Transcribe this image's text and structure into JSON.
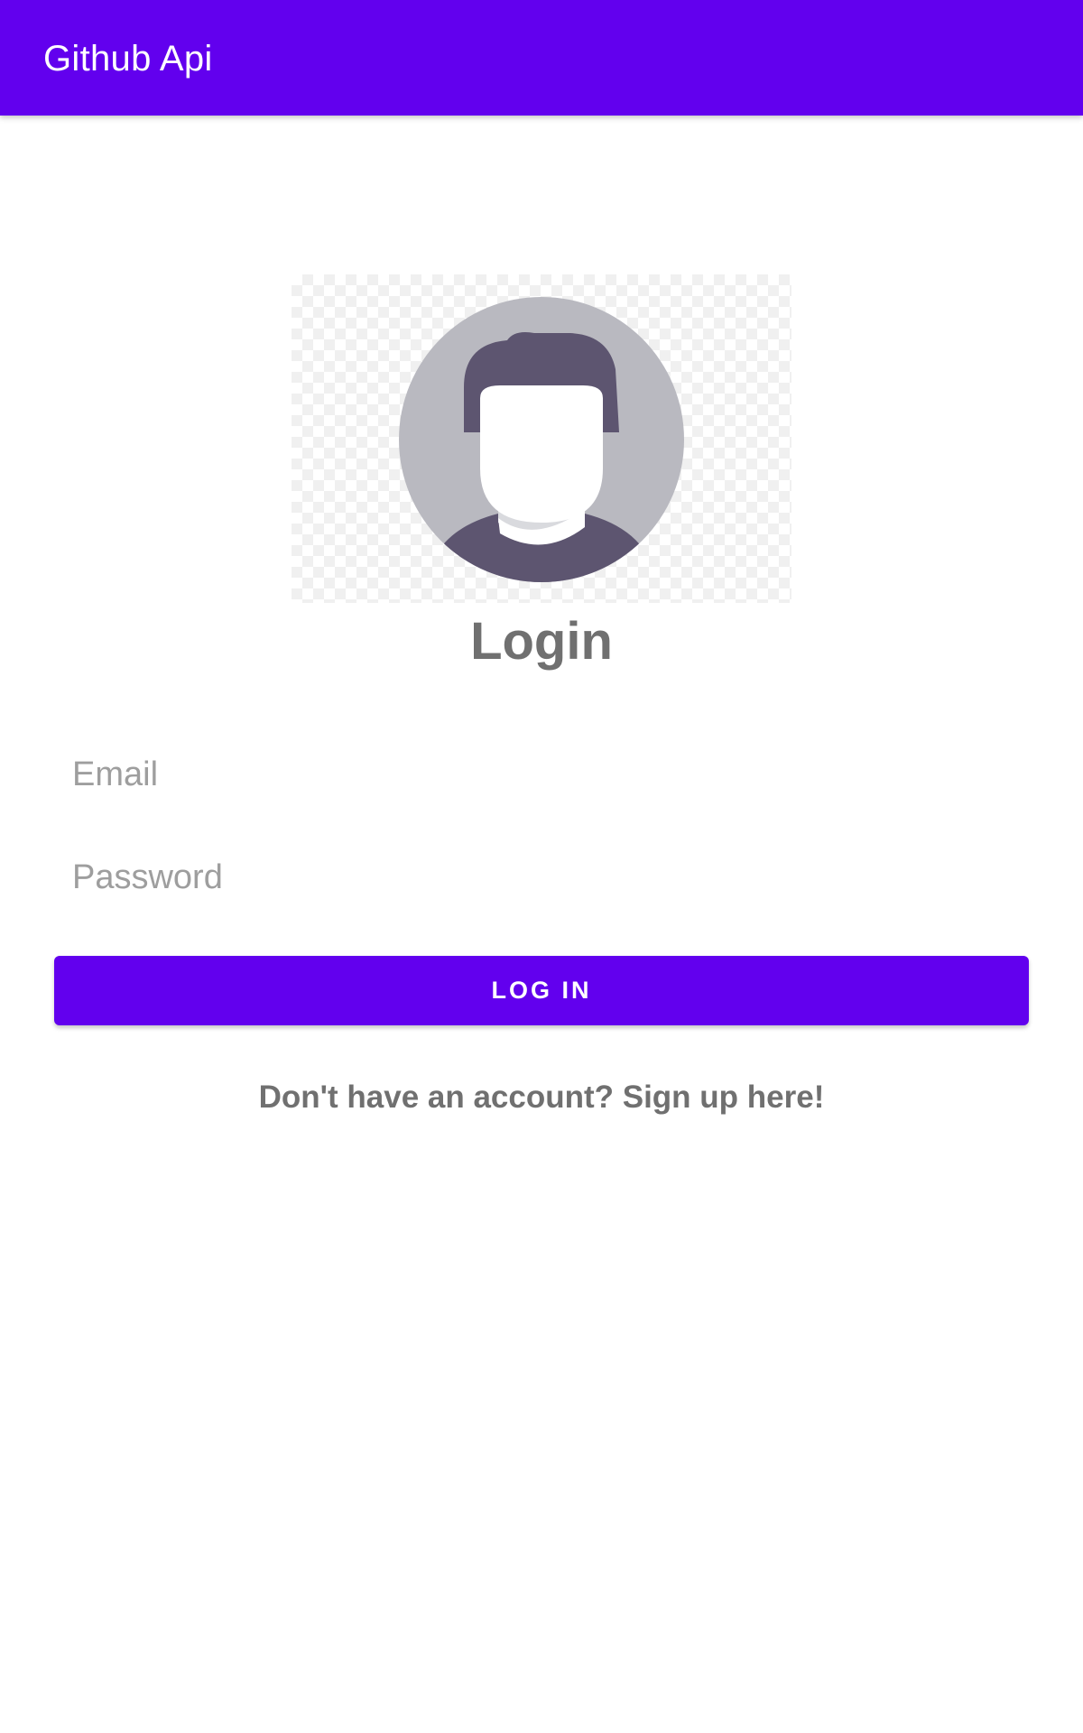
{
  "app_bar": {
    "title": "Github Api",
    "color": "#6200EE"
  },
  "avatar": {
    "icon": "default-user-avatar-icon"
  },
  "login_form": {
    "title": "Login",
    "email_placeholder": "Email",
    "password_placeholder": "Password",
    "login_button_label": "LOG IN",
    "signup_link": "Don't have an account? Sign up here!"
  },
  "colors": {
    "accent": "#6200EE",
    "heading_text": "#707070",
    "placeholder_text": "#9e9e9e"
  }
}
